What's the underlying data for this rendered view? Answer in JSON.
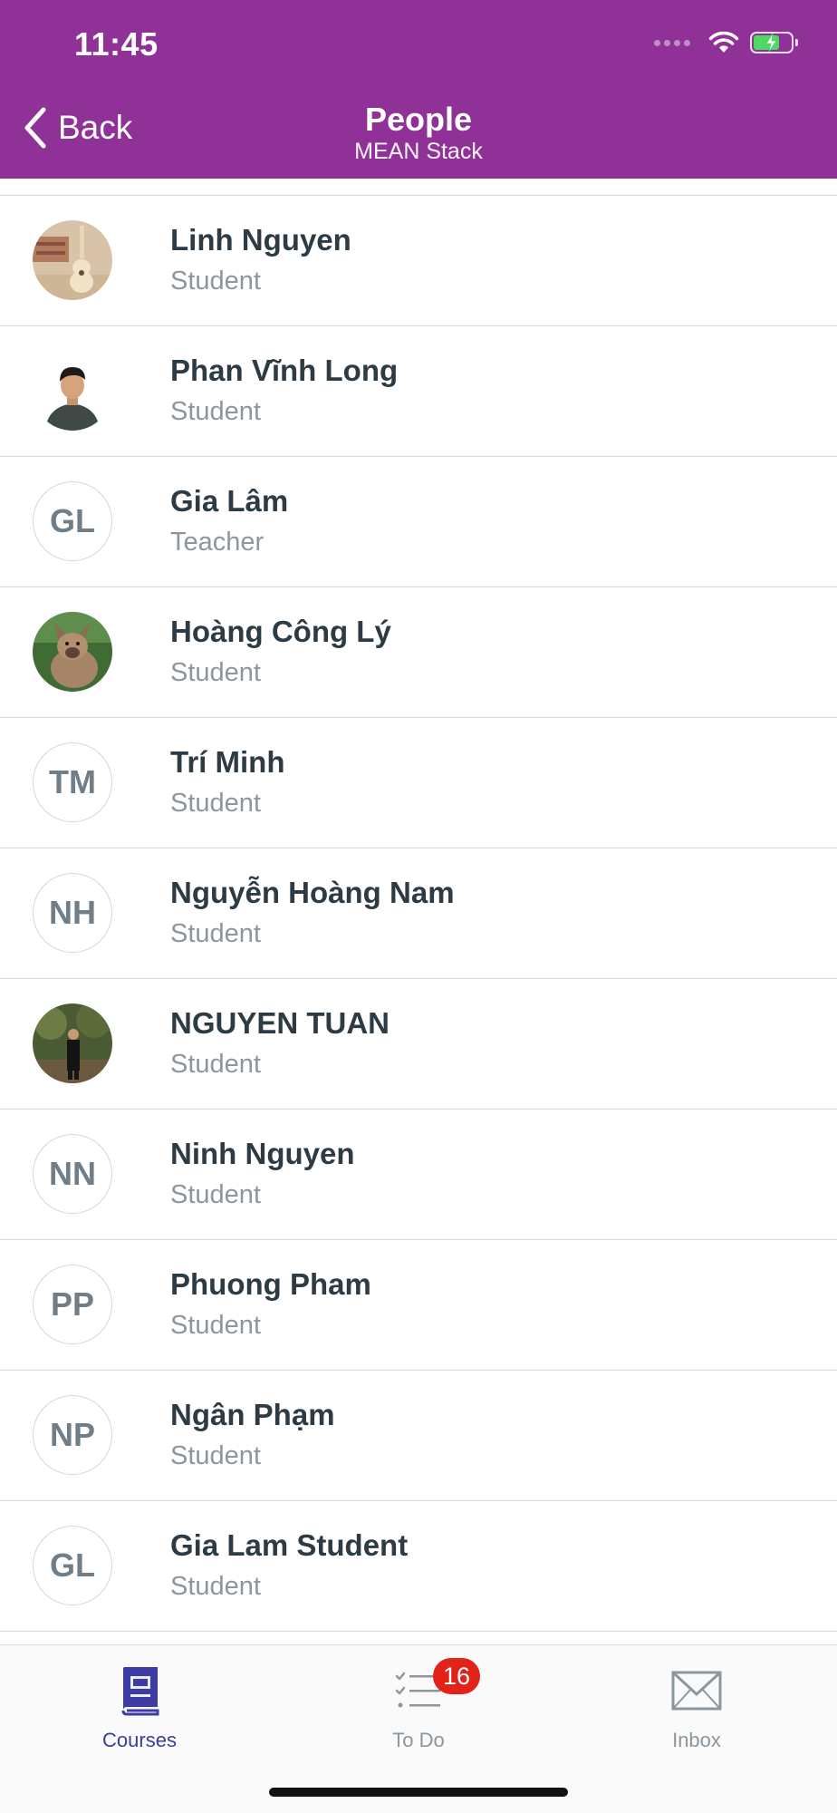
{
  "status_bar": {
    "time": "11:45"
  },
  "header": {
    "back_label": "Back",
    "title": "People",
    "subtitle": "MEAN Stack",
    "background_color": "#8f3197"
  },
  "people": [
    {
      "name": "Linh Nguyen",
      "role": "Student",
      "avatar": "photo",
      "photo": "guitar-photo"
    },
    {
      "name": "Phan Vĩnh Long",
      "role": "Student",
      "avatar": "photo",
      "photo": "portrait-photo"
    },
    {
      "name": "Gia Lâm",
      "role": "Teacher",
      "avatar": "initials",
      "initials": "GL"
    },
    {
      "name": "Hoàng Công Lý",
      "role": "Student",
      "avatar": "photo",
      "photo": "dog-photo"
    },
    {
      "name": "Trí Minh",
      "role": "Student",
      "avatar": "initials",
      "initials": "TM"
    },
    {
      "name": "Nguyễn Hoàng Nam",
      "role": "Student",
      "avatar": "initials",
      "initials": "NH"
    },
    {
      "name": "NGUYEN TUAN",
      "role": "Student",
      "avatar": "photo",
      "photo": "outdoor-portrait-photo"
    },
    {
      "name": "Ninh Nguyen",
      "role": "Student",
      "avatar": "initials",
      "initials": "NN"
    },
    {
      "name": "Phuong Pham",
      "role": "Student",
      "avatar": "initials",
      "initials": "PP"
    },
    {
      "name": "Ngân Phạm",
      "role": "Student",
      "avatar": "initials",
      "initials": "NP"
    },
    {
      "name": "Gia Lam Student",
      "role": "Student",
      "avatar": "initials",
      "initials": "GL"
    }
  ],
  "tabbar": {
    "tabs": [
      {
        "label": "Courses",
        "icon": "book-icon",
        "active": true
      },
      {
        "label": "To Do",
        "icon": "checklist-icon",
        "active": false,
        "badge": "16"
      },
      {
        "label": "Inbox",
        "icon": "envelope-icon",
        "active": false
      }
    ],
    "active_color": "#3d3ca3",
    "badge_color": "#e2231a"
  }
}
